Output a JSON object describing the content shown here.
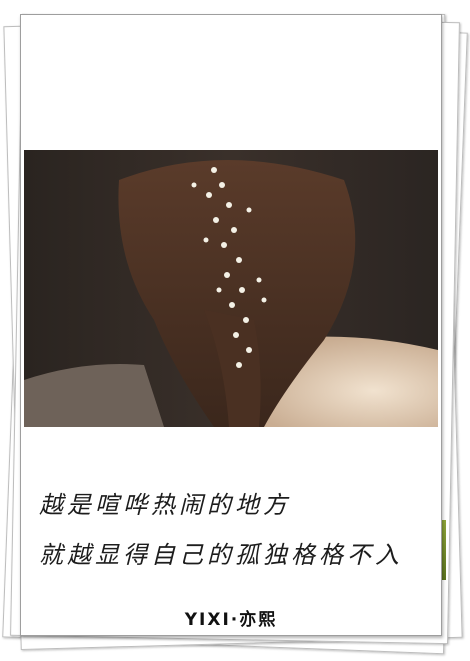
{
  "quote": {
    "line1": "越是喧哗热闹的地方",
    "line2": "就越显得自己的孤独格格不入"
  },
  "signature": "YIXI·亦熙",
  "colors": {
    "paper": "#ffffff",
    "text": "#1d1d1d",
    "accent_edge": "#7a9530"
  }
}
